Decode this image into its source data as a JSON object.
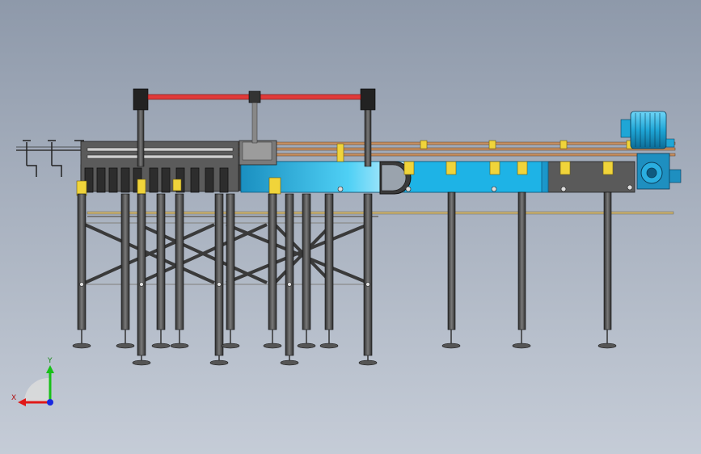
{
  "viewport": {
    "background_top": "#8e99aa",
    "background_bottom": "#c5ccd7"
  },
  "model": {
    "frame_color": "#4a4a4a",
    "conveyor_color": "#1eb3e6",
    "guide_rail_color": "#c89060",
    "top_beam_color": "#e03a3a",
    "bracket_color": "#f0d43a",
    "motor_color": "#1fa6d6"
  },
  "triad": {
    "x_label": "X",
    "y_label": "Y",
    "x_color": "#e01818",
    "y_color": "#18c018",
    "z_color": "#1828e0"
  }
}
